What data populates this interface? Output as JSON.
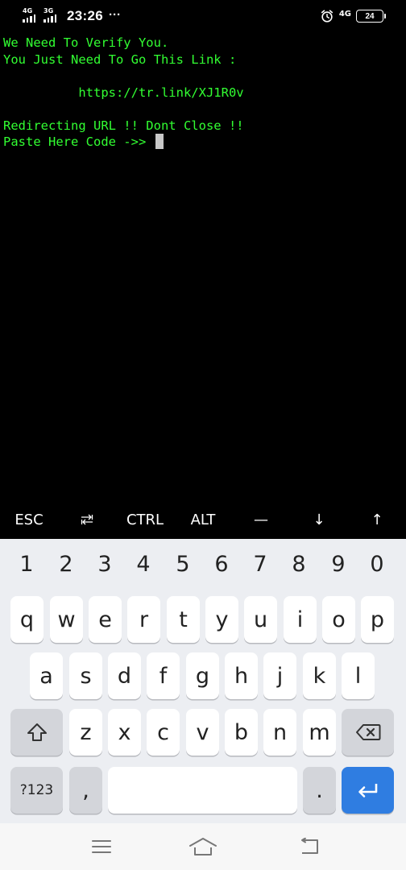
{
  "status_bar": {
    "signal_1": "4G",
    "signal_2": "3G",
    "time": "23:26",
    "more": "···",
    "network": "4G",
    "battery": "24",
    "icons": [
      "signal-bars-icon",
      "alarm-clock-icon",
      "battery-icon"
    ]
  },
  "terminal": {
    "lines": [
      "We Need To Verify You.",
      "You Just Need To Go This Link :",
      "",
      "          https://tr.link/XJ1R0v",
      "",
      "Redirecting URL !! Dont Close !!",
      "Paste Here Code ->> "
    ],
    "text_color": "#32ff32",
    "background": "#000000"
  },
  "extra_keys": [
    "ESC",
    "↹",
    "CTRL",
    "ALT",
    "—",
    "↓",
    "↑"
  ],
  "keyboard": {
    "number_row": [
      "1",
      "2",
      "3",
      "4",
      "5",
      "6",
      "7",
      "8",
      "9",
      "0"
    ],
    "row1": [
      "q",
      "w",
      "e",
      "r",
      "t",
      "y",
      "u",
      "i",
      "o",
      "p"
    ],
    "row2": [
      "a",
      "s",
      "d",
      "f",
      "g",
      "h",
      "j",
      "k",
      "l"
    ],
    "row3": [
      "z",
      "x",
      "c",
      "v",
      "b",
      "n",
      "m"
    ],
    "symbols_label": "?123",
    "comma_label": ",",
    "period_label": ".",
    "space_label": "",
    "icons": [
      "shift-icon",
      "backspace-icon",
      "enter-icon"
    ],
    "enter_color": "#2f7de1"
  },
  "nav_bar": {
    "icons": [
      "menu-icon",
      "home-icon",
      "back-icon"
    ]
  }
}
